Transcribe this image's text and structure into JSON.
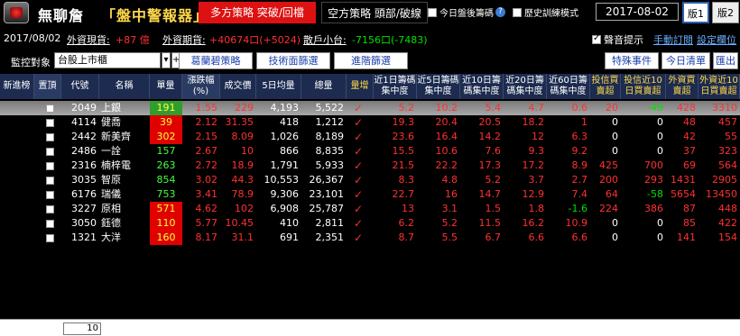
{
  "title": {
    "app_name": "無聊詹",
    "app_sub": "「盤中警報器」"
  },
  "strategy": {
    "long_label": "多方策略  突破/回檔",
    "short_label": "空方策略  頭部/破線"
  },
  "options": {
    "today_only_label": "今日盤後籌碼",
    "history_label": "歷史訓練模式",
    "help_icon": "?"
  },
  "date": "2017-08-02",
  "versions": [
    "版1",
    "版2"
  ],
  "market": {
    "date_label": "2017/08/02",
    "spot_label": "外資現貨:",
    "spot_value": "+87 億",
    "futures_label": "外資期貨:",
    "futures_value": "+40674口(+5024)",
    "retail_label": "散戶小台:",
    "retail_value": "-7156口(-7483)",
    "sound_label": "聲音提示",
    "manual_sub_label": "手動訂閱",
    "settings_label": "設定欄位"
  },
  "controls": {
    "monitor_label": "監控對象",
    "monitor_value": "台股上市櫃",
    "plus_label": "+",
    "arrow_label": "▾",
    "buttons": [
      "葛蘭碧策略",
      "技術面篩選",
      "進階篩選"
    ],
    "right_buttons": [
      "特殊事件",
      "今日清單",
      "匯出"
    ]
  },
  "table": {
    "headers": [
      "新進榜",
      "置頂",
      "代號",
      "名稱",
      "單量",
      "漲跌幅(%)",
      "成交價",
      "5日均量",
      "總量",
      "量增",
      "近1日籌碼集中度",
      "近5日籌碼集中度",
      "近10日籌碼集中度",
      "近20日籌碼集中度",
      "近60日籌碼集中度",
      "投信買賣超",
      "投信近10日買賣超",
      "外資買賣超",
      "外資近10日買賣超"
    ],
    "rows": [
      {
        "code": "2049",
        "name": "上銀",
        "vol": "191",
        "chg": "1.55",
        "price": "229",
        "avg5": "4,193",
        "total": "5,522",
        "c1": "5.2",
        "c5": "10.2",
        "c10": "5.4",
        "c20": "4.7",
        "c60": "0.6",
        "it": "20",
        "it10": "-49",
        "fi": "428",
        "fi10": "3310"
      },
      {
        "code": "4114",
        "name": "健喬",
        "vol": "39",
        "chg": "2.12",
        "price": "31.35",
        "avg5": "418",
        "total": "1,212",
        "c1": "19.3",
        "c5": "20.4",
        "c10": "20.5",
        "c20": "18.2",
        "c60": "1",
        "it": "0",
        "it10": "0",
        "fi": "48",
        "fi10": "457"
      },
      {
        "code": "2442",
        "name": "新美齊",
        "vol": "302",
        "chg": "2.15",
        "price": "8.09",
        "avg5": "1,026",
        "total": "8,189",
        "c1": "23.6",
        "c5": "16.4",
        "c10": "14.2",
        "c20": "12",
        "c60": "6.3",
        "it": "0",
        "it10": "0",
        "fi": "42",
        "fi10": "55"
      },
      {
        "code": "2486",
        "name": "一詮",
        "vol": "157",
        "chg": "2.67",
        "price": "10",
        "avg5": "866",
        "total": "8,835",
        "c1": "15.5",
        "c5": "10.6",
        "c10": "7.6",
        "c20": "9.3",
        "c60": "9.2",
        "it": "0",
        "it10": "0",
        "fi": "37",
        "fi10": "323"
      },
      {
        "code": "2316",
        "name": "楠梓電",
        "vol": "263",
        "chg": "2.72",
        "price": "18.9",
        "avg5": "1,791",
        "total": "5,933",
        "c1": "21.5",
        "c5": "22.2",
        "c10": "17.3",
        "c20": "17.2",
        "c60": "8.9",
        "it": "425",
        "it10": "700",
        "fi": "69",
        "fi10": "564"
      },
      {
        "code": "3035",
        "name": "智原",
        "vol": "854",
        "chg": "3.02",
        "price": "44.3",
        "avg5": "10,553",
        "total": "26,367",
        "c1": "8.3",
        "c5": "4.8",
        "c10": "5.2",
        "c20": "3.7",
        "c60": "2.7",
        "it": "200",
        "it10": "293",
        "fi": "1431",
        "fi10": "2905"
      },
      {
        "code": "6176",
        "name": "瑞儀",
        "vol": "753",
        "chg": "3.41",
        "price": "78.9",
        "avg5": "9,306",
        "total": "23,101",
        "c1": "22.7",
        "c5": "16",
        "c10": "14.7",
        "c20": "12.9",
        "c60": "7.4",
        "it": "64",
        "it10": "-58",
        "fi": "5654",
        "fi10": "13450"
      },
      {
        "code": "3227",
        "name": "原相",
        "vol": "571",
        "chg": "4.62",
        "price": "102",
        "avg5": "6,908",
        "total": "25,787",
        "c1": "13",
        "c5": "3.1",
        "c10": "1.5",
        "c20": "1.8",
        "c60": "-1.6",
        "it": "224",
        "it10": "386",
        "fi": "87",
        "fi10": "448"
      },
      {
        "code": "3050",
        "name": "鈺德",
        "vol": "110",
        "chg": "5.77",
        "price": "10.45",
        "avg5": "410",
        "total": "2,811",
        "c1": "6.2",
        "c5": "5.2",
        "c10": "11.5",
        "c20": "16.2",
        "c60": "10.9",
        "it": "0",
        "it10": "0",
        "fi": "85",
        "fi10": "422"
      },
      {
        "code": "1321",
        "name": "大洋",
        "vol": "160",
        "chg": "8.17",
        "price": "31.1",
        "avg5": "691",
        "total": "2,351",
        "c1": "8.7",
        "c5": "5.5",
        "c10": "6.7",
        "c20": "6.6",
        "c60": "6.6",
        "it": "0",
        "it10": "0",
        "fi": "141",
        "fi10": "154"
      }
    ],
    "volume_highlight": [
      "yellow-on-green",
      "red",
      "red",
      "green",
      "green",
      "green",
      "green",
      "red",
      "red",
      "red"
    ]
  },
  "footer": {
    "page_value": "10"
  },
  "colors": {
    "accent_red": "#d11",
    "up_red": "#ff3030",
    "down_green": "#00e000",
    "header_bg": "#1c2b4f"
  }
}
